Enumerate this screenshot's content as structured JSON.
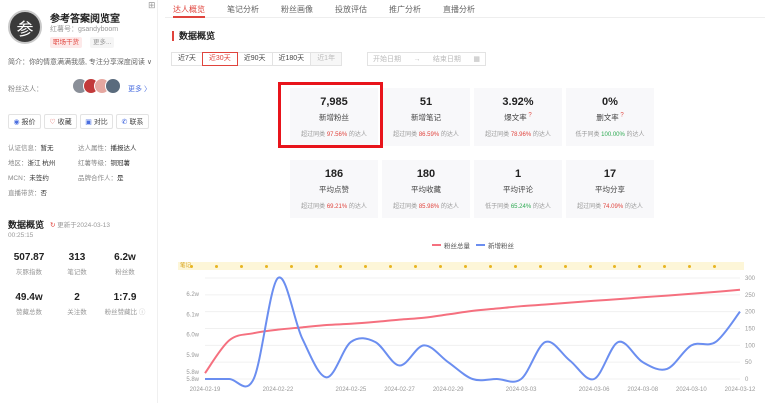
{
  "profile": {
    "avatar_char": "参",
    "name": "参考答案阅览室",
    "red_id": "红薯号：gsandyboom",
    "tags": [
      "职场干货",
      "更多..."
    ],
    "bio": "简介：你的情意满满我感, 专注分享深度阅读 ∨",
    "fans_label": "粉丝达人：",
    "more_link": "更多 〉",
    "actions": [
      {
        "icon": "price-icon",
        "glyph": "◉",
        "label": "报价"
      },
      {
        "icon": "heart-icon",
        "glyph": "♡",
        "label": "收藏"
      },
      {
        "icon": "compare-icon",
        "glyph": "▣",
        "label": "对比"
      },
      {
        "icon": "contact-icon",
        "glyph": "✆",
        "label": "联系"
      }
    ],
    "info": [
      {
        "k": "认证信息：",
        "v": "暂无"
      },
      {
        "k": "达人属性：",
        "v": "播报达人"
      },
      {
        "k": "地区：",
        "v": "浙江 杭州"
      },
      {
        "k": "红薯等级：",
        "v": "铜冠薯"
      },
      {
        "k": "MCN：",
        "v": "未签约"
      },
      {
        "k": "品牌合作人：",
        "v": "是"
      },
      {
        "k": "直播带货：",
        "v": "否"
      }
    ],
    "overview_title": "数据概览",
    "update_text": "更新于2024-03-13",
    "update_time": "00:25:15",
    "stats": [
      {
        "value": "507.87",
        "label": "灰豚指数"
      },
      {
        "value": "313",
        "label": "笔记数"
      },
      {
        "value": "6.2w",
        "label": "粉丝数"
      },
      {
        "value": "49.4w",
        "label": "赞藏总数"
      },
      {
        "value": "2",
        "label": "关注数"
      },
      {
        "value": "1:7.9",
        "label": "粉丝赞藏比"
      }
    ]
  },
  "tabs": [
    "达人概览",
    "笔记分析",
    "粉丝画像",
    "投放评估",
    "推广分析",
    "直播分析"
  ],
  "section_title": "数据概览",
  "range_buttons": [
    "近7天",
    "近30天",
    "近90天",
    "近180天",
    "近1年"
  ],
  "date_range": {
    "start": "开始日期",
    "sep": "→",
    "end": "结束日期"
  },
  "cards": [
    {
      "value": "7,985",
      "label": "新增粉丝",
      "prefix": "超过同类",
      "pct": "97.56%",
      "suffix": "的达人",
      "pct_color": "red"
    },
    {
      "value": "51",
      "label": "新增笔记",
      "prefix": "超过同类",
      "pct": "86.59%",
      "suffix": "的达人",
      "pct_color": "red"
    },
    {
      "value": "3.92%",
      "label": "爆文率",
      "prefix": "超过同类",
      "pct": "78.96%",
      "suffix": "的达人",
      "pct_color": "red",
      "mark": "?"
    },
    {
      "value": "0%",
      "label": "删文率",
      "prefix": "低于同类",
      "pct": "100.00%",
      "suffix": "的达人",
      "pct_color": "green",
      "mark": "?"
    },
    {
      "value": "186",
      "label": "平均点赞",
      "prefix": "超过同类",
      "pct": "69.21%",
      "suffix": "的达人",
      "pct_color": "red"
    },
    {
      "value": "180",
      "label": "平均收藏",
      "prefix": "超过同类",
      "pct": "85.98%",
      "suffix": "的达人",
      "pct_color": "red"
    },
    {
      "value": "1",
      "label": "平均评论",
      "prefix": "低于同类",
      "pct": "65.24%",
      "suffix": "的达人",
      "pct_color": "green"
    },
    {
      "value": "17",
      "label": "平均分享",
      "prefix": "超过同类",
      "pct": "74.09%",
      "suffix": "的达人",
      "pct_color": "red"
    }
  ],
  "timeline_label": "笔记",
  "colors": {
    "accent": "#e0443d",
    "total": "#f5707f",
    "new": "#6b8ef0",
    "green": "#2eaa52"
  },
  "chart_data": {
    "type": "line",
    "legend": [
      "粉丝总量",
      "新增粉丝"
    ],
    "x": [
      "2024-02-19",
      "2024-02-20",
      "2024-02-21",
      "2024-02-22",
      "2024-02-23",
      "2024-02-24",
      "2024-02-25",
      "2024-02-26",
      "2024-02-27",
      "2024-02-28",
      "2024-02-29",
      "2024-03-01",
      "2024-03-02",
      "2024-03-03",
      "2024-03-04",
      "2024-03-05",
      "2024-03-06",
      "2024-03-07",
      "2024-03-08",
      "2024-03-09",
      "2024-03-10",
      "2024-03-11",
      "2024-03-12"
    ],
    "x_ticks": [
      "2024-02-19",
      "2024-02-22",
      "2024-02-25",
      "2024-02-27",
      "2024-02-29",
      "2024-03-03",
      "2024-03-06",
      "2024-03-08",
      "2024-03-10",
      "2024-03-12"
    ],
    "y_left_ticks": [
      "5.8w",
      "5.8w",
      "5.9w",
      "6.0w",
      "6.1w",
      "6.2w"
    ],
    "y_right_ticks": [
      "0",
      "50",
      "100",
      "150",
      "200",
      "250",
      "300"
    ],
    "series": [
      {
        "name": "粉丝总量",
        "axis": "left",
        "values": [
          58200,
          59600,
          59900,
          60050,
          60150,
          60250,
          60300,
          60380,
          60480,
          60560,
          60700,
          60850,
          60950,
          61050,
          61120,
          61200,
          61280,
          61350,
          61430,
          61500,
          61580,
          61660,
          61750
        ]
      },
      {
        "name": "新增粉丝",
        "axis": "right",
        "values": [
          0,
          0,
          0,
          300,
          120,
          5,
          110,
          110,
          40,
          100,
          50,
          0,
          0,
          0,
          110,
          55,
          0,
          110,
          50,
          30,
          100,
          110,
          200
        ]
      }
    ],
    "y_left_range": [
      57950,
      62250
    ],
    "y_right_range": [
      0,
      300
    ]
  }
}
